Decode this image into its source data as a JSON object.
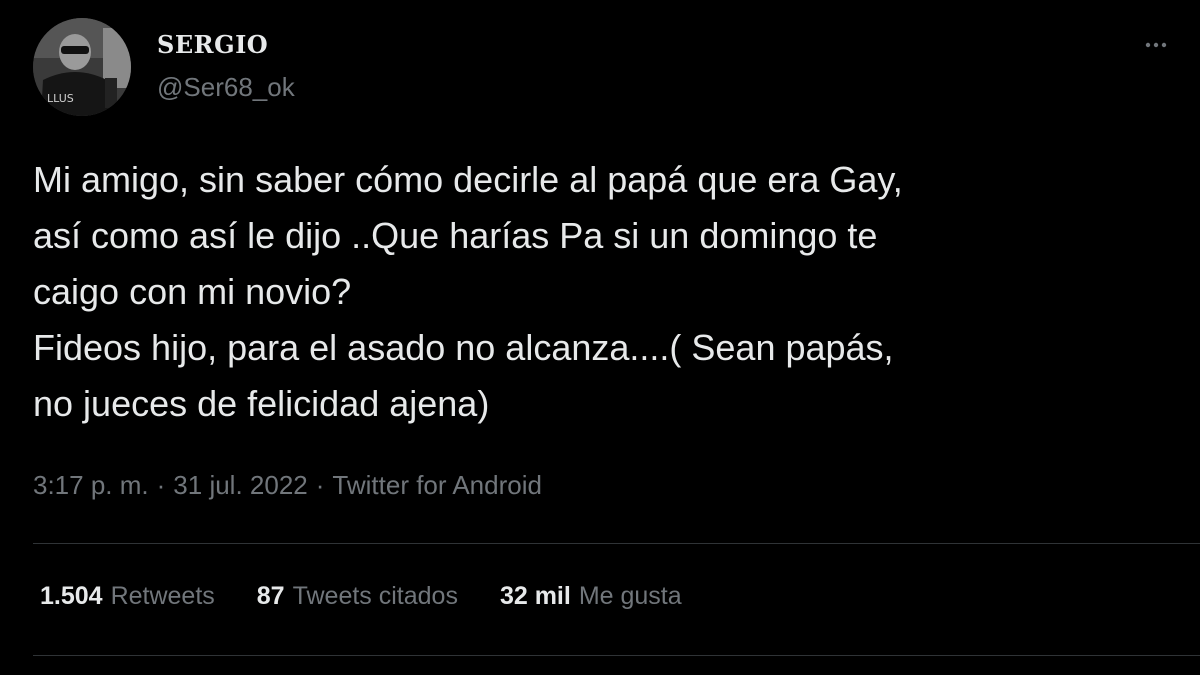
{
  "author": {
    "display_name": "SERGIO",
    "handle": "@Ser68_ok"
  },
  "menu": {
    "icon": "more-horizontal-icon"
  },
  "tweet": {
    "text": "Mi amigo, sin saber cómo decirle al papá que era Gay,\nasí como así le dijo ..Que harías Pa si un domingo te\ncaigo con mi novio?\nFideos hijo, para el asado no alcanza....( Sean papás,\nno jueces de felicidad ajena)",
    "time": "3:17 p. m.",
    "date": "31 jul. 2022",
    "source": "Twitter for Android",
    "separator": "·"
  },
  "stats": {
    "retweets_count": "1.504",
    "retweets_label": "Retweets",
    "quotes_count": "87",
    "quotes_label": "Tweets citados",
    "likes_count": "32 mil",
    "likes_label": "Me gusta"
  },
  "colors": {
    "background": "#000000",
    "primary_text": "#e7e9ea",
    "secondary_text": "#71767b",
    "divider": "#2f3336"
  }
}
